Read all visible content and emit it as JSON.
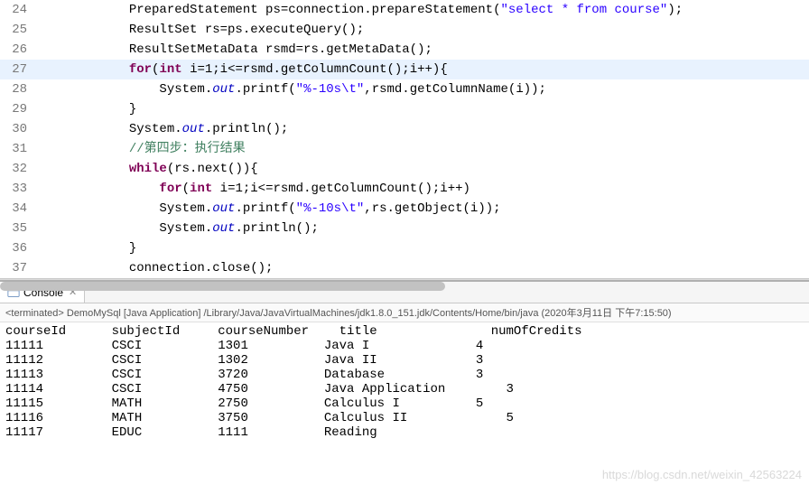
{
  "editor": {
    "first_line": 24,
    "highlight_line": 27,
    "lines": [
      {
        "tokens": [
          {
            "t": "plain",
            "v": "            PreparedStatement ps=connection.prepareStatement("
          },
          {
            "t": "str",
            "v": "\"select * from course\""
          },
          {
            "t": "plain",
            "v": ");"
          }
        ]
      },
      {
        "tokens": [
          {
            "t": "plain",
            "v": "            ResultSet rs=ps.executeQuery();"
          }
        ]
      },
      {
        "tokens": [
          {
            "t": "plain",
            "v": "            ResultSetMetaData rsmd=rs.getMetaData();"
          }
        ]
      },
      {
        "tokens": [
          {
            "t": "plain",
            "v": "            "
          },
          {
            "t": "kw",
            "v": "for"
          },
          {
            "t": "plain",
            "v": "("
          },
          {
            "t": "kw",
            "v": "int"
          },
          {
            "t": "plain",
            "v": " i=1;i<=rsmd.getColumnCount();i++){"
          }
        ]
      },
      {
        "tokens": [
          {
            "t": "plain",
            "v": "                System."
          },
          {
            "t": "static",
            "v": "out"
          },
          {
            "t": "plain",
            "v": ".printf("
          },
          {
            "t": "str",
            "v": "\"%-10s\\t\""
          },
          {
            "t": "plain",
            "v": ",rsmd.getColumnName(i));"
          }
        ]
      },
      {
        "tokens": [
          {
            "t": "plain",
            "v": "            }"
          }
        ]
      },
      {
        "tokens": [
          {
            "t": "plain",
            "v": "            System."
          },
          {
            "t": "static",
            "v": "out"
          },
          {
            "t": "plain",
            "v": ".println();"
          }
        ]
      },
      {
        "tokens": [
          {
            "t": "plain",
            "v": "            "
          },
          {
            "t": "cmt",
            "v": "//第四步：执行结果"
          }
        ]
      },
      {
        "tokens": [
          {
            "t": "plain",
            "v": "            "
          },
          {
            "t": "kw",
            "v": "while"
          },
          {
            "t": "plain",
            "v": "(rs.next()){"
          }
        ]
      },
      {
        "tokens": [
          {
            "t": "plain",
            "v": "                "
          },
          {
            "t": "kw",
            "v": "for"
          },
          {
            "t": "plain",
            "v": "("
          },
          {
            "t": "kw",
            "v": "int"
          },
          {
            "t": "plain",
            "v": " i=1;i<=rsmd.getColumnCount();i++)"
          }
        ]
      },
      {
        "tokens": [
          {
            "t": "plain",
            "v": "                System."
          },
          {
            "t": "static",
            "v": "out"
          },
          {
            "t": "plain",
            "v": ".printf("
          },
          {
            "t": "str",
            "v": "\"%-10s\\t\""
          },
          {
            "t": "plain",
            "v": ",rs.getObject(i));"
          }
        ]
      },
      {
        "tokens": [
          {
            "t": "plain",
            "v": "                System."
          },
          {
            "t": "static",
            "v": "out"
          },
          {
            "t": "plain",
            "v": ".println();"
          }
        ]
      },
      {
        "tokens": [
          {
            "t": "plain",
            "v": "            }"
          }
        ]
      },
      {
        "tokens": [
          {
            "t": "plain",
            "v": "            connection.close();"
          }
        ]
      }
    ]
  },
  "console": {
    "tab_label": "Console",
    "terminated_text": "<terminated> DemoMySql [Java Application] /Library/Java/JavaVirtualMachines/jdk1.8.0_151.jdk/Contents/Home/bin/java (2020年3月11日 下午7:15:50)",
    "columns": [
      "courseId",
      "subjectId",
      "courseNumber",
      "title",
      "numOfCredits"
    ],
    "rows": [
      [
        "11111",
        "CSCI",
        "1301",
        "Java I",
        "4"
      ],
      [
        "11112",
        "CSCI",
        "1302",
        "Java II",
        "3"
      ],
      [
        "11113",
        "CSCI",
        "3720",
        "Database",
        "3"
      ],
      [
        "11114",
        "CSCI",
        "4750",
        "Java Application",
        "3"
      ],
      [
        "11115",
        "MATH",
        "2750",
        "Calculus I",
        "5"
      ],
      [
        "11116",
        "MATH",
        "3750",
        "Calculus II",
        "5"
      ],
      [
        "11117",
        "EDUC",
        "1111",
        "Reading",
        ""
      ]
    ]
  },
  "watermark": "https://blog.csdn.net/weixin_42563224"
}
